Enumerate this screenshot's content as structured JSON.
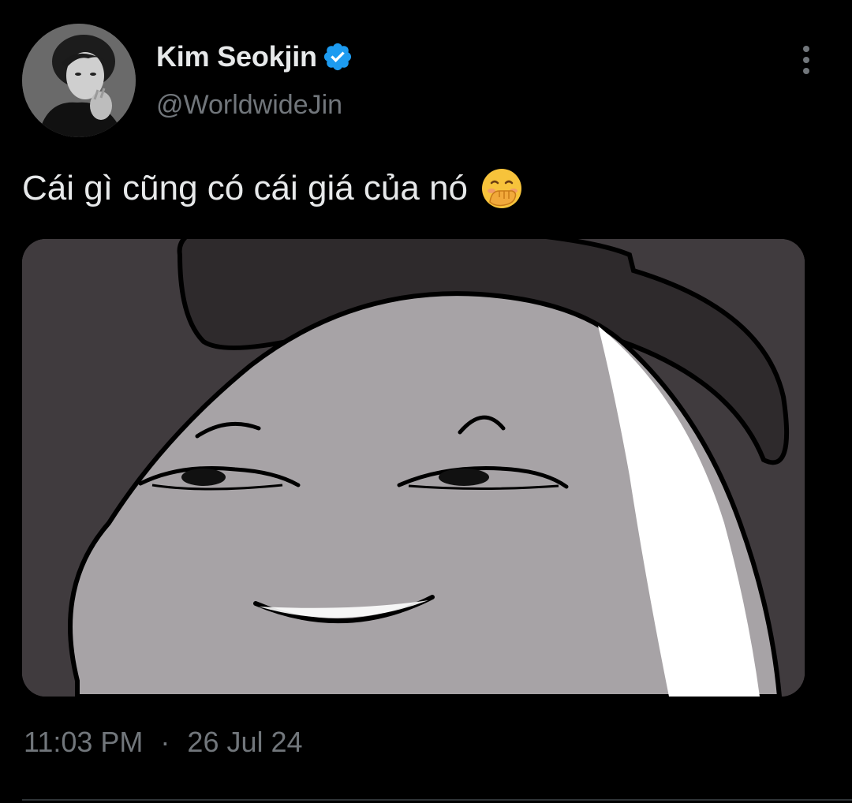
{
  "tweet": {
    "author": {
      "display_name": "Kim Seokjin",
      "handle": "@WorldwideJin",
      "verified": true,
      "verified_color": "#1d9bf0",
      "avatar_icon": "avatar-photo"
    },
    "text": "Cái gì cũng có cái giá của nó",
    "emoji_icon": "face-with-hand-over-mouth-icon",
    "media": {
      "icon": "cartoon-smug-face-image"
    },
    "time": "11:03 PM",
    "separator": "·",
    "date": "26 Jul 24"
  },
  "menu": {
    "icon": "more-vertical-icon"
  },
  "colors": {
    "background": "#000000",
    "primary_text": "#e7e9ea",
    "secondary_text": "#71767b"
  }
}
